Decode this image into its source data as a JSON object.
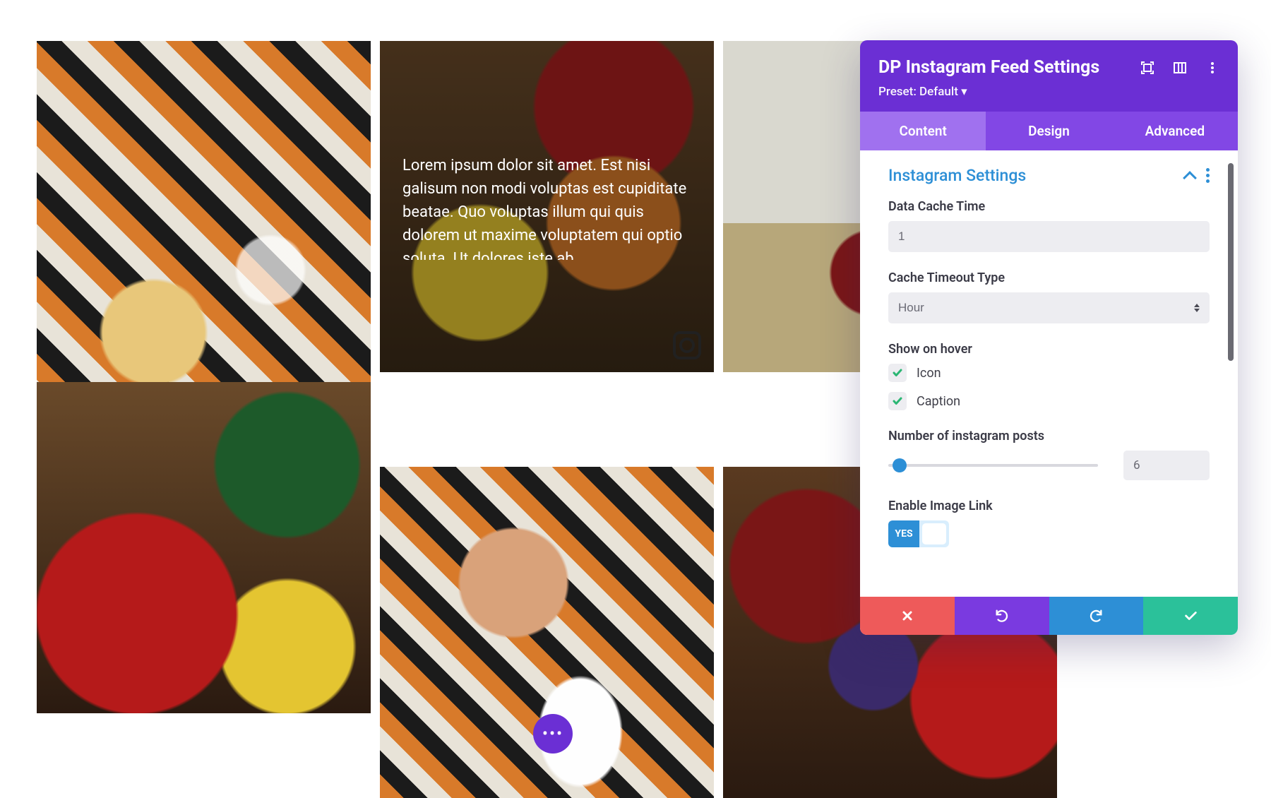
{
  "panel": {
    "title": "DP Instagram Feed Settings",
    "preset": "Preset: Default ▾",
    "tabs": {
      "content": "Content",
      "design": "Design",
      "advanced": "Advanced"
    },
    "section_title": "Instagram Settings",
    "fields": {
      "cache_time_label": "Data Cache Time",
      "cache_time_value": "1",
      "timeout_label": "Cache Timeout Type",
      "timeout_value": "Hour",
      "hover_label": "Show on hover",
      "hover_icon": "Icon",
      "hover_caption": "Caption",
      "posts_label": "Number of instagram posts",
      "posts_value": "6",
      "enable_link_label": "Enable Image Link",
      "enable_link_value": "YES"
    }
  },
  "feed": {
    "overlay_caption": "Lorem ipsum dolor sit amet. Est nisi galisum non modi voluptas est cupiditate beatae. Quo voluptas illum qui quis dolorem ut maxime voluptatem qui optio soluta. Ut dolores iste ab"
  }
}
